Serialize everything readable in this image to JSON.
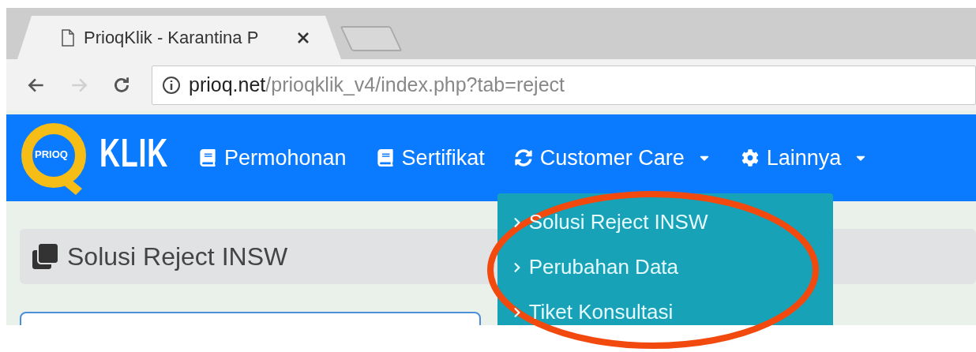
{
  "browser": {
    "tabs": [
      {
        "title": "PrioqKlik - Karantina P",
        "selected": true
      }
    ],
    "nav_buttons": [
      {
        "kind": "back",
        "disabled": false
      },
      {
        "kind": "forward",
        "disabled": true
      },
      {
        "kind": "reload",
        "disabled": false
      }
    ],
    "address": {
      "host": "prioq.net",
      "path": "/prioqklik_v4/index.php?tab=reject"
    }
  },
  "navbar": {
    "logo": {
      "badge": "PRIOQ",
      "wordmark": "KLIK"
    },
    "items": [
      {
        "label": "Permohonan",
        "kind": "book",
        "dropdown": false,
        "expanded": false
      },
      {
        "label": "Sertifikat",
        "kind": "book",
        "dropdown": false,
        "expanded": false
      },
      {
        "label": "Customer Care",
        "kind": "refresh",
        "dropdown": true,
        "expanded": true,
        "menu": [
          "Solusi Reject INSW",
          "Perubahan Data",
          "Tiket Konsultasi"
        ]
      },
      {
        "label": "Lainnya",
        "kind": "gear",
        "dropdown": true,
        "expanded": false
      }
    ]
  },
  "page": {
    "title": "Solusi Reject INSW"
  },
  "annotation": {
    "kind": "ellipse"
  }
}
